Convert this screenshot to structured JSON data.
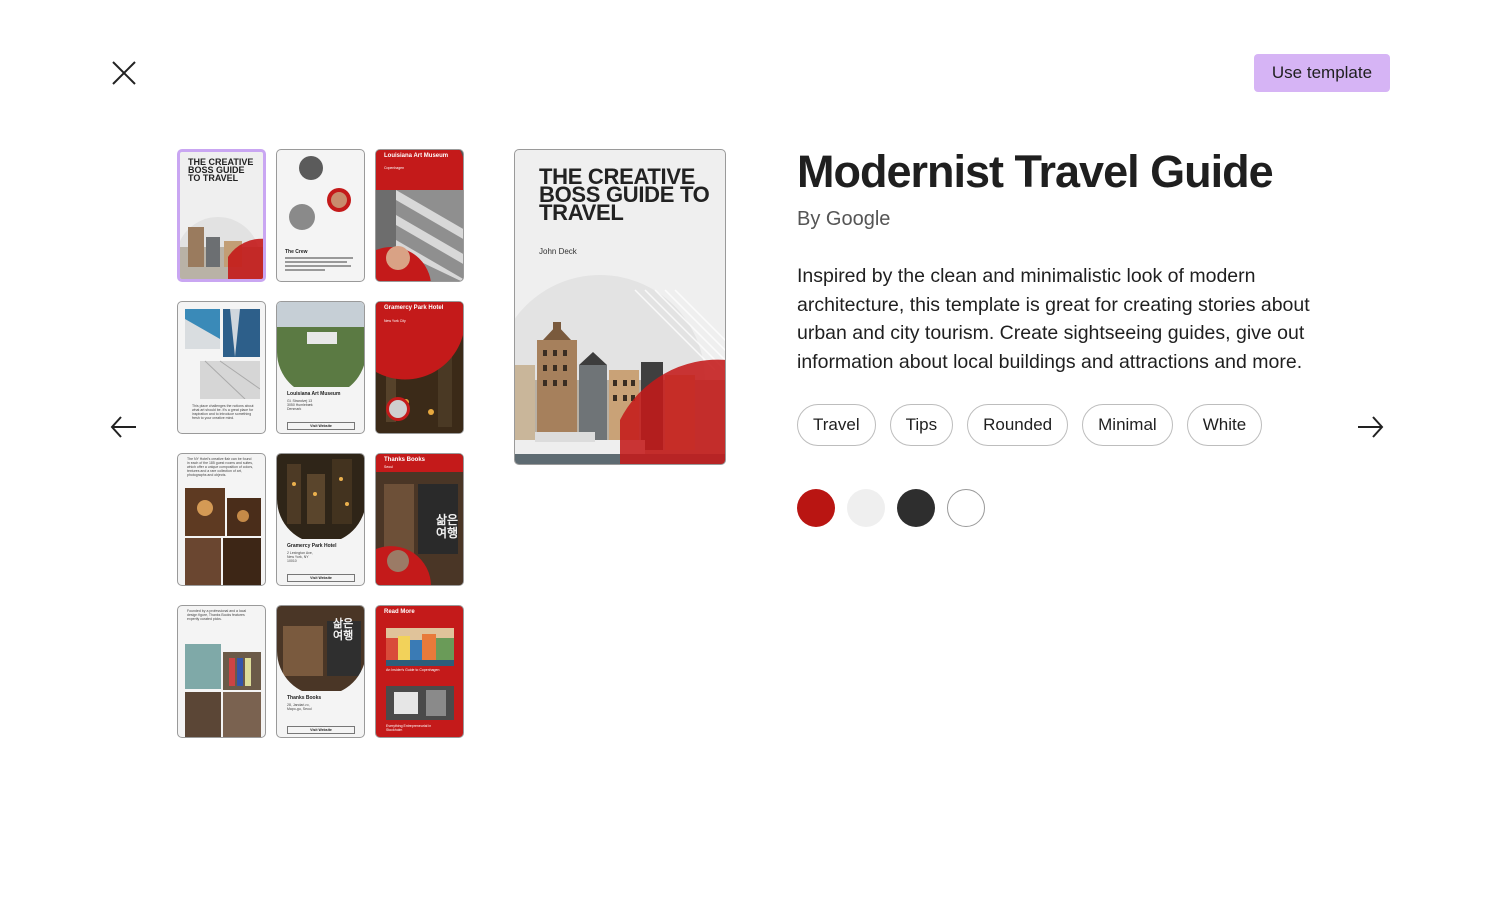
{
  "header": {
    "use_template_label": "Use template"
  },
  "template": {
    "title": "Modernist Travel Guide",
    "author": "By Google",
    "description": "Inspired by the clean and minimalistic look of modern architecture, this template is great for creating stories about urban and city tourism. Create sightseeing guides, give out information about local buildings and attractions and more."
  },
  "tags": [
    "Travel",
    "Tips",
    "Rounded",
    "Minimal",
    "White"
  ],
  "colors": [
    "#b91512",
    "#efefef",
    "#2e2e2e",
    "#ffffff"
  ],
  "preview": {
    "title": "THE CREATIVE BOSS GUIDE TO TRAVEL",
    "author": "John Deck"
  },
  "thumbnails": {
    "cover_title": "THE CREATIVE BOSS GUIDE TO TRAVEL",
    "crew": "The Crew",
    "louisiana_top": "Louisiana Art Museum",
    "copenhagen": "Copenhagen",
    "gramercy_top": "Gramercy Park Hotel",
    "new_york": "New York City",
    "louisiana_card": "Louisiana Art Museum",
    "gramercy_card": "Gramercy Park Hotel",
    "thanks_top": "Thanks Books",
    "seoul": "Seoul",
    "thanks_card": "Thanks Books",
    "read_more": "Read More",
    "visit_website": "Visit Website",
    "korean": "삶은 여행"
  }
}
